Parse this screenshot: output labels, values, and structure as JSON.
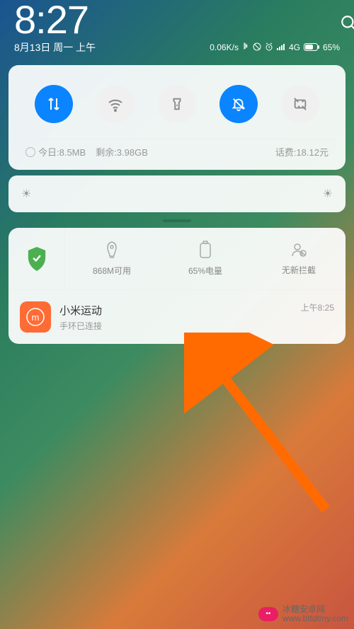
{
  "status": {
    "time": "8:27",
    "date": "8月13日 周一 上午",
    "speed": "0.06K/s",
    "signal": "4G",
    "battery": "65%"
  },
  "toggles": {
    "data": {
      "active": true,
      "name": "mobile-data"
    },
    "wifi": {
      "active": false,
      "name": "wifi"
    },
    "flashlight": {
      "active": false,
      "name": "flashlight"
    },
    "dnd": {
      "active": true,
      "name": "do-not-disturb"
    },
    "screenshot": {
      "active": false,
      "name": "screenshot"
    }
  },
  "data_usage": {
    "today": "今日:8.5MB",
    "remaining": "剩余:3.98GB",
    "bill": "话费:18.12元"
  },
  "tools": {
    "memory": {
      "label": "868M可用"
    },
    "battery": {
      "label": "65%电量"
    },
    "block": {
      "label": "无新拦截"
    }
  },
  "notification": {
    "title": "小米运动",
    "subtitle": "手环已连接",
    "time": "上午8:25",
    "icon_letter": "m"
  },
  "watermark": {
    "brand": "冰糖安卓网",
    "url": "www.bttdtmy.com"
  }
}
